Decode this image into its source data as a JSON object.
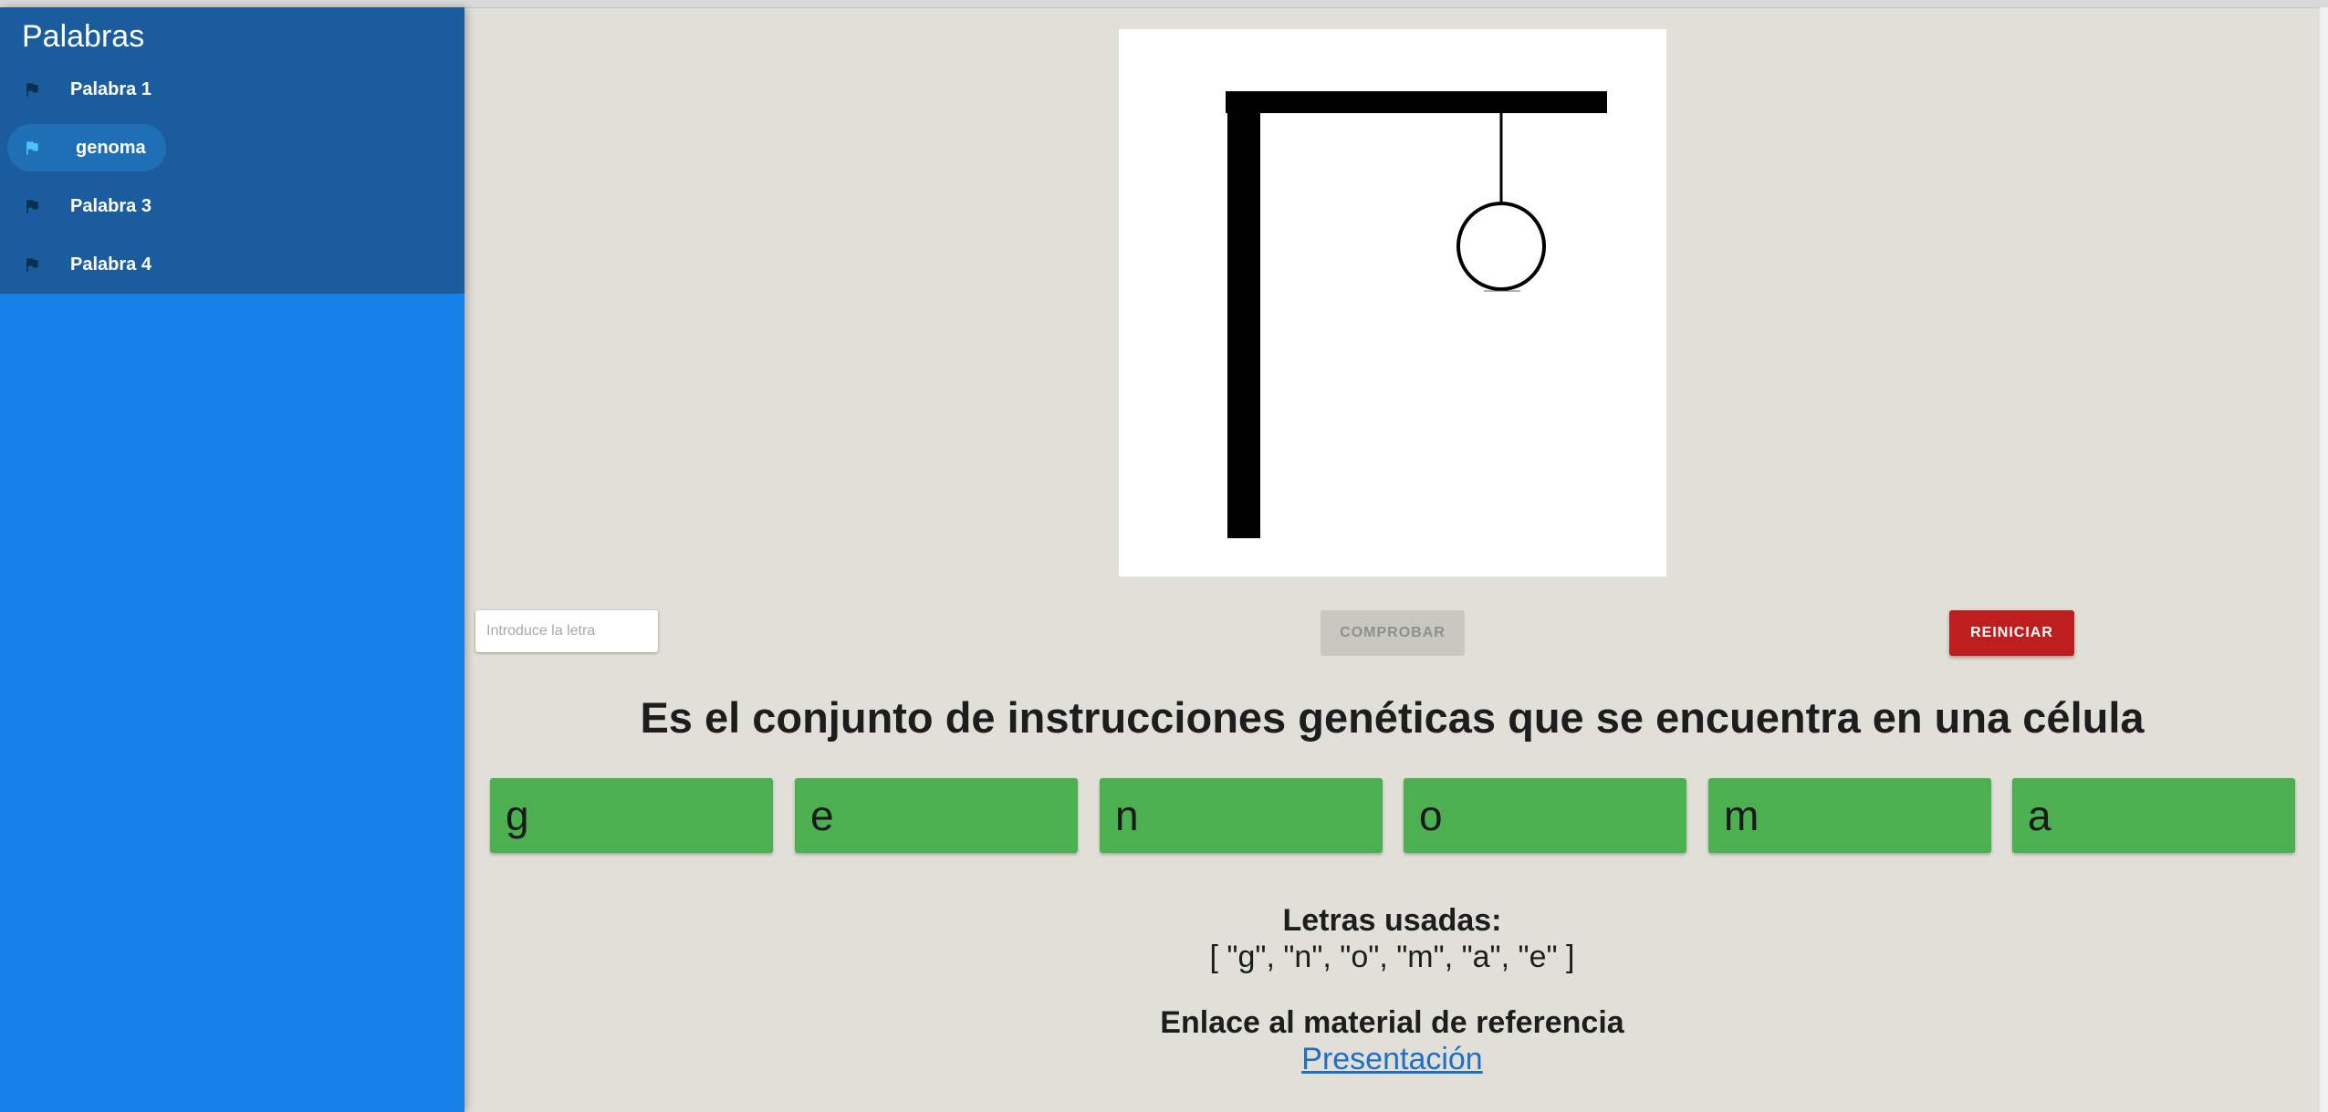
{
  "sidebar": {
    "title": "Palabras",
    "items": [
      {
        "label": "Palabra 1",
        "active": false
      },
      {
        "label": "genoma",
        "active": true
      },
      {
        "label": "Palabra 3",
        "active": false
      },
      {
        "label": "Palabra 4",
        "active": false
      }
    ],
    "icon": "flag-icon"
  },
  "game": {
    "input_placeholder": "Introduce la letra",
    "check_label": "Comprobar",
    "reset_label": "Reiniciar",
    "clue": "Es el conjunto de instrucciones genéticas que se encuentra en una célula",
    "letters": [
      "g",
      "e",
      "n",
      "o",
      "m",
      "a"
    ],
    "used_title": "Letras usadas:",
    "used_letters": "[ \"g\", \"n\", \"o\", \"m\", \"a\", \"e\" ]",
    "reference_title": "Enlace al material de referencia",
    "reference_link": "Presentación"
  },
  "colors": {
    "sidebar_panel": "#1b5c9f",
    "sidebar_background": "#1580e8",
    "active_flag": "#4fc3f7",
    "inactive_flag": "#0d2f52",
    "letter_box": "#4caf50",
    "reset_button": "#be1e1e",
    "check_button_disabled": "#c8c8c0",
    "link": "#1f6fc6"
  }
}
